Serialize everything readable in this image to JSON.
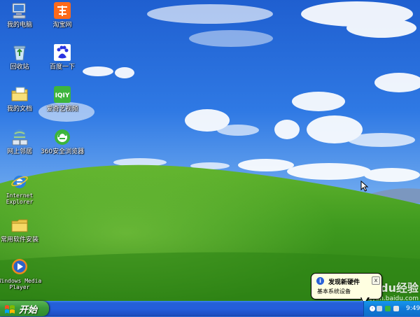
{
  "desktop": {
    "icons": [
      {
        "label": "我的电脑",
        "icon": "computer-icon"
      },
      {
        "label": "淘宝网",
        "icon": "taobao-icon"
      },
      {
        "label": "回收站",
        "icon": "recycle-bin-icon"
      },
      {
        "label": "百度一下",
        "icon": "baidu-icon"
      },
      {
        "label": "我的文档",
        "icon": "documents-icon"
      },
      {
        "label": "爱奇艺视频",
        "icon": "iqiyi-icon"
      },
      {
        "label": "网上邻居",
        "icon": "network-icon"
      },
      {
        "label": "360安全浏览器",
        "icon": "360-browser-icon"
      },
      {
        "label": "Internet Explorer",
        "icon": "internet-explorer-icon"
      },
      {
        "label": "常用软件安装",
        "icon": "folder-icon"
      },
      {
        "label": "Windows Media Player",
        "icon": "media-player-icon"
      }
    ]
  },
  "taskbar": {
    "start_label": "开始",
    "clock": "9:49"
  },
  "balloon": {
    "title": "发现新硬件",
    "text": "基本系统设备",
    "close": "x"
  },
  "watermark": {
    "main": "Baidu经验",
    "url": "jingyan.baidu.com"
  },
  "colors": {
    "taskbar": "#245edb",
    "start": "#3c9b3a",
    "tray": "#0f7ad8",
    "balloon": "#ffffe1"
  }
}
